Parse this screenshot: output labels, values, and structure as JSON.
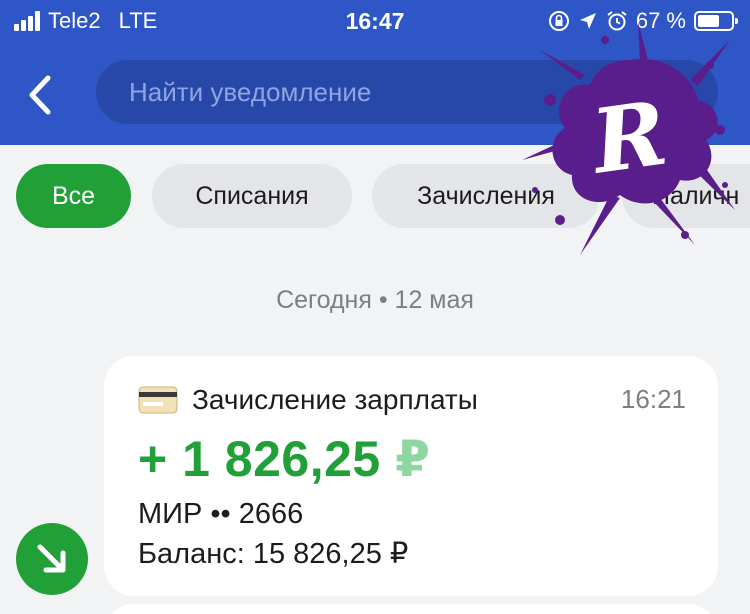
{
  "status_bar": {
    "carrier": "Tele2",
    "network": "LTE",
    "time": "16:47",
    "battery_percent": "67 %",
    "battery_level": 0.67,
    "icons": [
      "orientation-lock-icon",
      "location-arrow-icon",
      "alarm-clock-icon",
      "battery-icon"
    ]
  },
  "header": {
    "back_icon": "chevron-left-icon",
    "search_placeholder": "Найти уведомление",
    "search_icon": "search-icon"
  },
  "filters": [
    {
      "label": "Все",
      "active": true
    },
    {
      "label": "Списания",
      "active": false
    },
    {
      "label": "Зачисления",
      "active": false
    },
    {
      "label": "Наличн",
      "active": false
    }
  ],
  "date_separator": "Сегодня • 12 мая",
  "notification": {
    "icon": "bank-card-icon",
    "title": "Зачисление зарплаты",
    "time": "16:21",
    "amount": "+ 1 826,25",
    "currency": "₽",
    "account": "МИР •• 2666",
    "balance": "Баланс: 15 826,25 ₽",
    "badge_icon": "arrow-down-right-icon"
  },
  "colors": {
    "header": "#2f56c6",
    "accent_green": "#21a038",
    "background": "#f2f3f5",
    "watermark": "#5a1d8c"
  },
  "watermark": {
    "letter": "R",
    "icon": "ink-splash-logo"
  }
}
